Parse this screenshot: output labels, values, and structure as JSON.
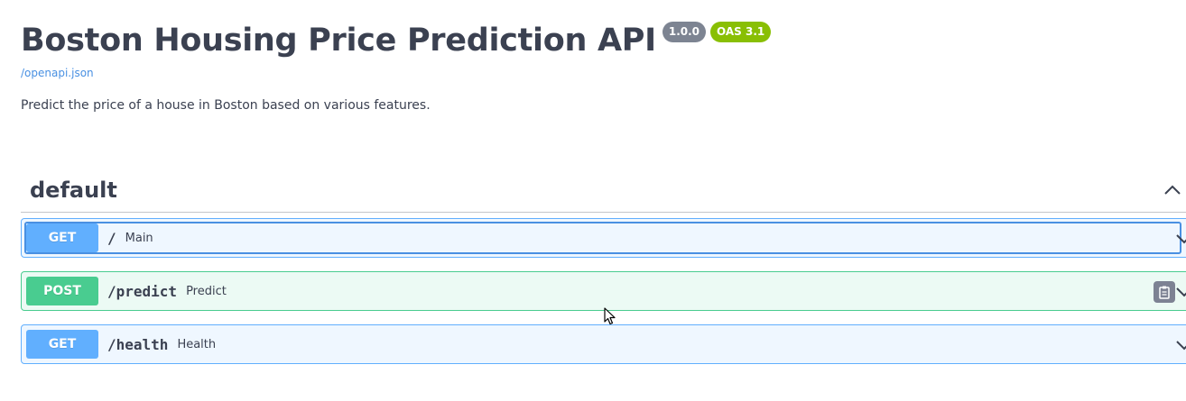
{
  "info": {
    "title": "Boston Housing Price Prediction API",
    "version_badge": "1.0.0",
    "oas_badge": "OAS 3.1",
    "spec_link": "/openapi.json",
    "description": "Predict the price of a house in Boston based on various features."
  },
  "tag": {
    "name": "default",
    "expanded": true
  },
  "operations": [
    {
      "method": "GET",
      "path": "/",
      "summary": "Main"
    },
    {
      "method": "POST",
      "path": "/predict",
      "summary": "Predict"
    },
    {
      "method": "GET",
      "path": "/health",
      "summary": "Health"
    }
  ],
  "colors": {
    "get": "#61affe",
    "post": "#49cc90",
    "version_badge": "#7d8492",
    "oas_badge": "#89bf04",
    "link": "#4990e2",
    "text": "#3b4151"
  }
}
